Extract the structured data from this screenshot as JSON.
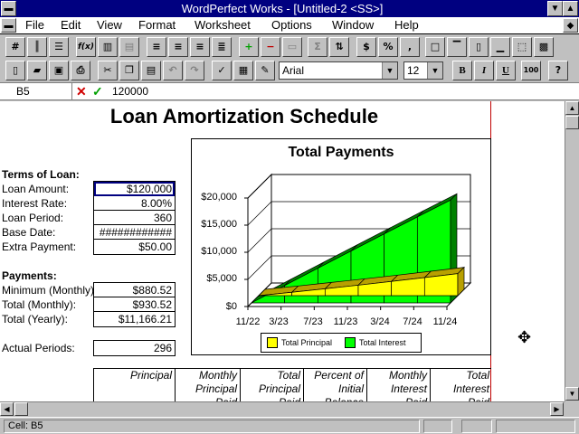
{
  "window": {
    "title": "WordPerfect Works - [Untitled-2 <SS>]"
  },
  "menu": [
    "File",
    "Edit",
    "View",
    "Format",
    "Worksheet",
    "Options",
    "Window",
    "Help"
  ],
  "toolbar_format": {
    "currency_label": "$",
    "percent_label": "%",
    "comma_label": ",",
    "sum_label": "Σ",
    "function_label": "f(x)"
  },
  "toolbar_main": {
    "font": "Arial",
    "font_size": "12",
    "bold_label": "B",
    "italic_label": "I",
    "underline_label": "U",
    "zoom_label": "100",
    "help_label": "?"
  },
  "formula_bar": {
    "cell_ref": "B5",
    "content": "120000"
  },
  "sheet": {
    "title": "Loan Amortization Schedule",
    "terms_heading": "Terms of Loan:",
    "terms": [
      {
        "label": "Loan Amount:",
        "value": "$120,000"
      },
      {
        "label": "Interest Rate:",
        "value": "8.00%"
      },
      {
        "label": "Loan Period:",
        "value": "360"
      },
      {
        "label": "Base Date:",
        "value": "############"
      },
      {
        "label": "Extra Payment:",
        "value": "$50.00"
      }
    ],
    "payments_heading": "Payments:",
    "payments": [
      {
        "label": "Minimum (Monthly):",
        "value": "$880.52"
      },
      {
        "label": "Total (Monthly):",
        "value": "$930.52"
      },
      {
        "label": "Total (Yearly):",
        "value": "$11,166.21"
      }
    ],
    "actual_periods_label": "Actual Periods:",
    "actual_periods_value": "296",
    "table_headers": [
      "Principal",
      "Monthly\nPrincipal\nPaid",
      "Total\nPrincipal\nPaid",
      "Percent of\nInitial\nBalance",
      "Monthly\nInterest\nPaid",
      "Total\nInterest\nPaid"
    ]
  },
  "chart_data": {
    "type": "area",
    "title": "Total Payments",
    "x_ticks": [
      "11/22",
      "3/23",
      "7/23",
      "11/23",
      "3/24",
      "7/24",
      "11/24"
    ],
    "y_ticks": [
      "$0",
      "$5,000",
      "$10,000",
      "$15,000",
      "$20,000"
    ],
    "ylim": [
      0,
      20000
    ],
    "three_d": true,
    "legend_position": "bottom",
    "series": [
      {
        "name": "Total Principal",
        "color": "#ffff00",
        "values": [
          0,
          620,
          1270,
          1930,
          2620,
          3330,
          4060
        ]
      },
      {
        "name": "Total Interest",
        "color": "#00ff00",
        "values": [
          0,
          3200,
          6390,
          9560,
          12710,
          15840,
          18950
        ]
      }
    ]
  },
  "status": {
    "cell": "Cell: B5"
  }
}
